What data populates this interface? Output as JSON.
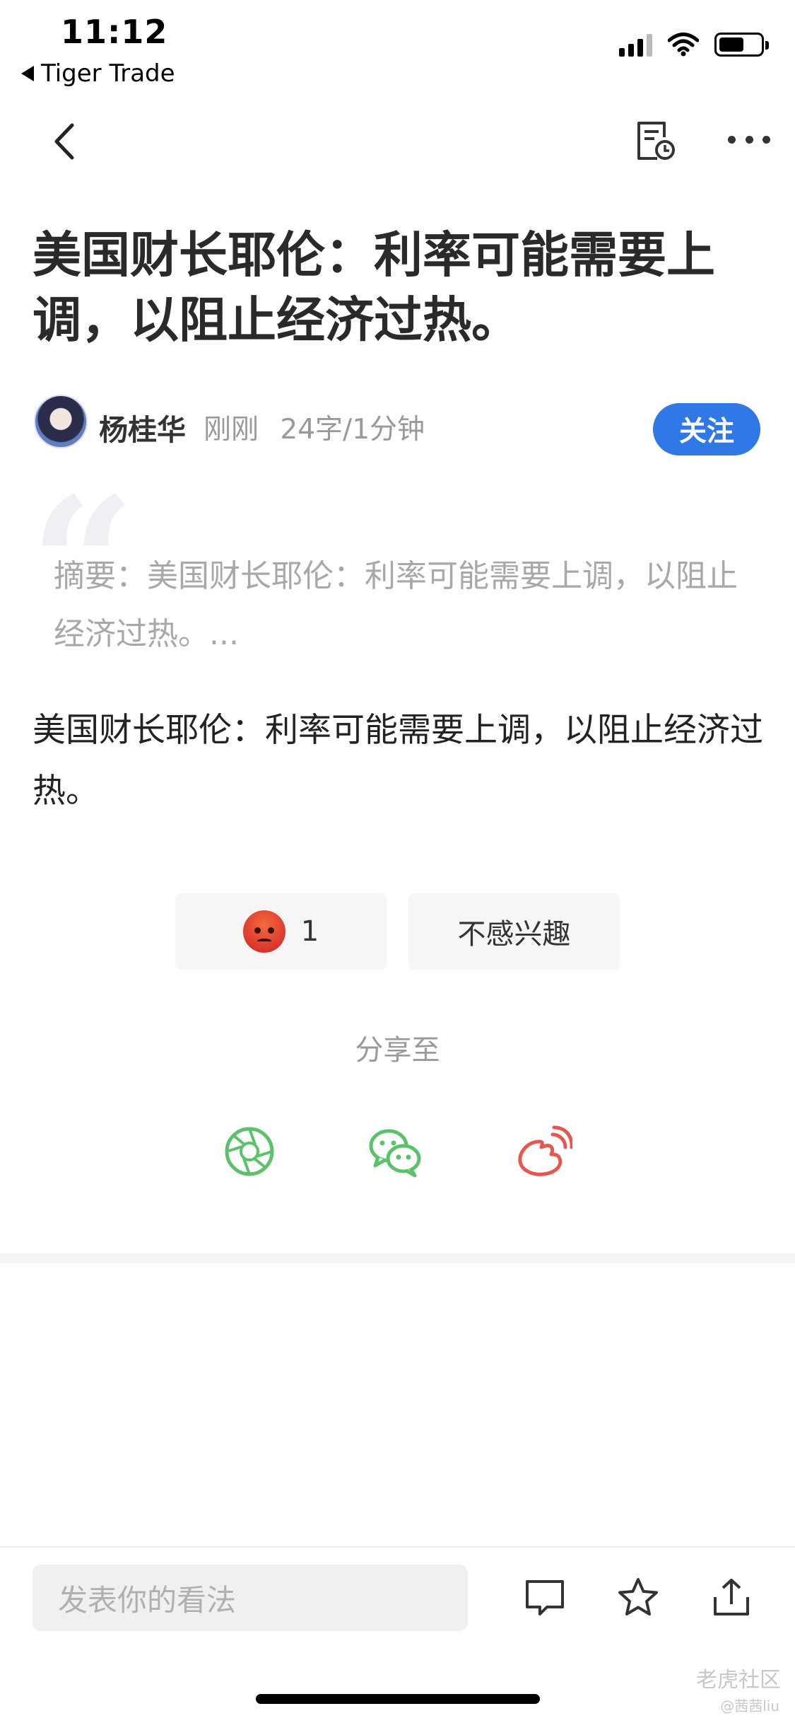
{
  "status_bar": {
    "time": "11:12",
    "back_app": "Tiger Trade"
  },
  "article": {
    "title": "美国财长耶伦：利率可能需要上调，以阻止经济过热。",
    "author": "杨桂华",
    "time": "刚刚",
    "stats": "24字/1分钟",
    "follow_label": "关注",
    "summary": "摘要：美国财长耶伦：利率可能需要上调，以阻止经济过热。...",
    "body": "美国财长耶伦：利率可能需要上调，以阻止经济过热。"
  },
  "reactions": {
    "angry_count": "1",
    "not_interested_label": "不感兴趣"
  },
  "share": {
    "label": "分享至",
    "targets": [
      "moments-icon",
      "wechat-icon",
      "weibo-icon"
    ]
  },
  "bottom_bar": {
    "comment_placeholder": "发表你的看法"
  },
  "watermark": {
    "brand": "老虎社区",
    "user": "@茜茜liu"
  },
  "colors": {
    "accent": "#2f78e6",
    "wechat_green": "#5ac26b",
    "weibo_red": "#e5584f"
  }
}
